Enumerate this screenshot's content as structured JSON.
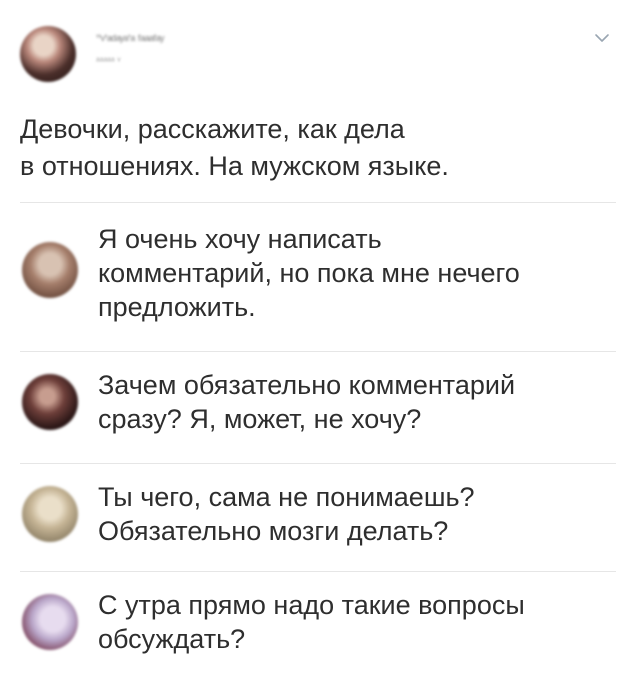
{
  "post": {
    "author_name": "ʼʼᵛʼᵃᵈᵃʸᵃʼᵃ ᶠᵃᵃᵃᶠᵃʸ",
    "author_handle": "ᵃᵃᵃᵃᵃ ᵛ",
    "text_line1": "Девочки, расскажите, как дела",
    "text_line2": "в отношениях. На мужском языке."
  },
  "comments": [
    {
      "line1": "Я очень хочу написать",
      "line2": "комментарий, но пока мне нечего",
      "line3": "предложить."
    },
    {
      "line1": "Зачем обязательно комментарий",
      "line2": "сразу? Я, может, не хочу?"
    },
    {
      "line1": "Ты чего, сама не понимаешь?",
      "line2": "Обязательно мозги делать?"
    },
    {
      "line1": "С утра прямо надо такие вопросы",
      "line2": "обсуждать?"
    }
  ],
  "icons": {
    "menu": "chevron-down-icon"
  },
  "colors": {
    "text": "#2e2e2e",
    "divider": "#e6e6e6",
    "background": "#ffffff"
  }
}
